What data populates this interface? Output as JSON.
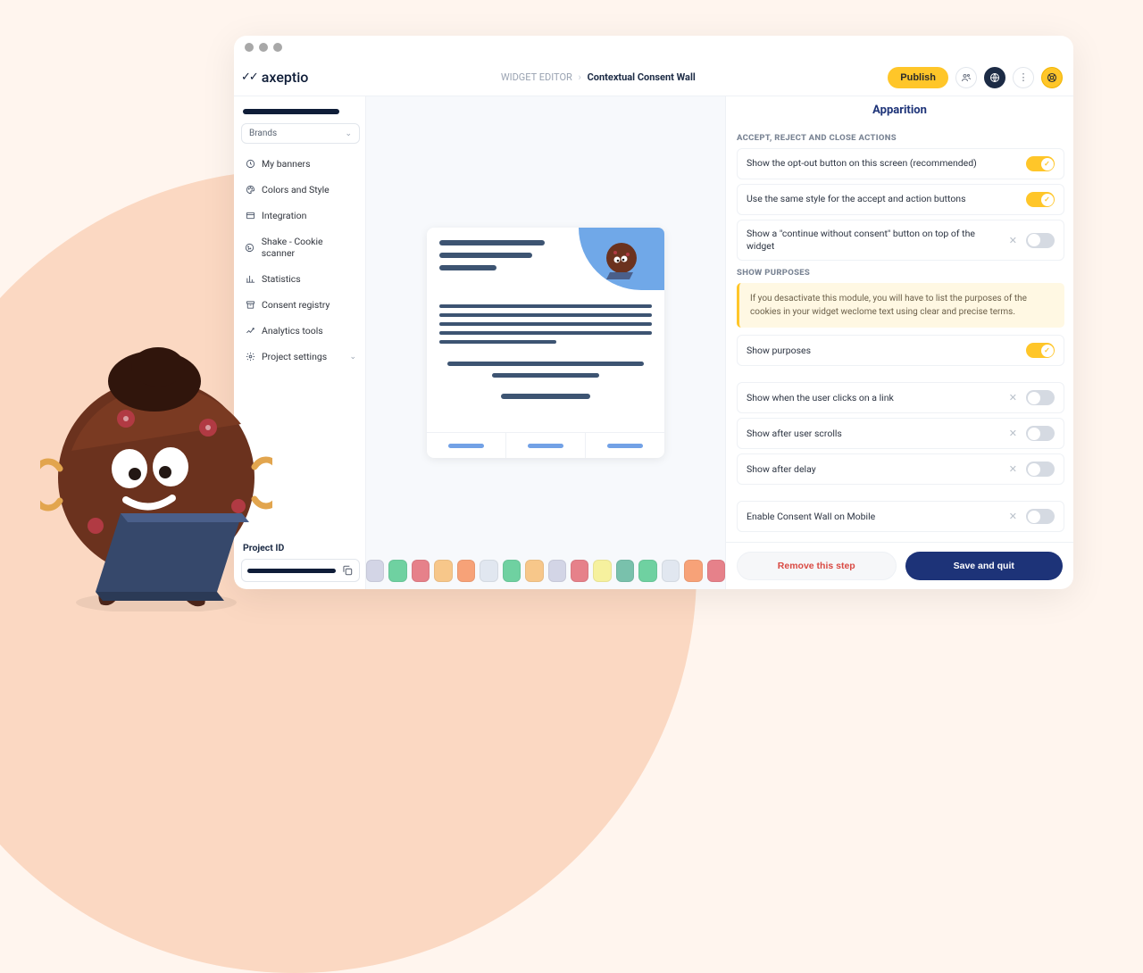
{
  "app": {
    "logo_text": "axeptio"
  },
  "breadcrumb": {
    "editor": "WIDGET EDITOR",
    "page": "Contextual Consent Wall"
  },
  "header": {
    "publish": "Publish"
  },
  "sidebar": {
    "brands_label": "Brands",
    "items": [
      {
        "label": "My banners"
      },
      {
        "label": "Colors and Style"
      },
      {
        "label": "Integration"
      },
      {
        "label": "Shake - Cookie scanner"
      },
      {
        "label": "Statistics"
      },
      {
        "label": "Consent registry"
      },
      {
        "label": "Analytics tools"
      },
      {
        "label": "Project settings"
      }
    ],
    "project_id_label": "Project ID"
  },
  "palette_colors": [
    "#d3d5e6",
    "#6fd1a1",
    "#e6818a",
    "#f7c78a",
    "#f7a278",
    "#e1e7f0",
    "#6fd1a1",
    "#f7c78a",
    "#d3d5e6",
    "#e6818a",
    "#f6f19e",
    "#79c1ac",
    "#6fd1a1",
    "#e1e7f0",
    "#f7a278",
    "#e6818a"
  ],
  "panel": {
    "title": "Apparition",
    "section_actions": "ACCEPT, REJECT AND CLOSE ACTIONS",
    "section_purposes": "SHOW PURPOSES",
    "info_text": "If you desactivate this module, you will have to list the purposes of the cookies in your widget weclome text using clear and precise terms.",
    "toggles": {
      "opt_out": "Show the opt-out button on this screen (recommended)",
      "same_style": "Use the same style for the accept and action buttons",
      "continue_without": "Show a \"continue without consent\" button on top of the widget",
      "show_purposes": "Show purposes",
      "on_link": "Show when the user clicks on a link",
      "on_scroll": "Show after user scrolls",
      "on_delay": "Show after delay",
      "mobile": "Enable Consent Wall on Mobile"
    },
    "remove": "Remove this step",
    "save": "Save and quit"
  }
}
